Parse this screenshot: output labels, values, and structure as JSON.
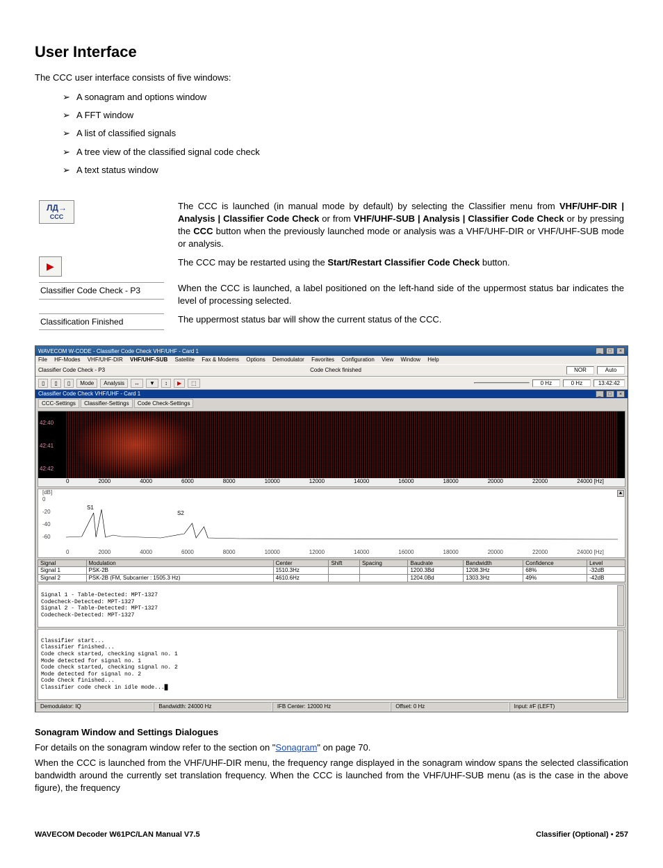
{
  "title": "User Interface",
  "intro": "The CCC user interface consists of five windows:",
  "bullets": [
    "A sonagram and options window",
    "A FFT window",
    "A list of classified signals",
    "A tree view of the classified signal code check",
    "A text status window"
  ],
  "rows": [
    {
      "left_kind": "ccc-icon",
      "html": "The CCC is launched (in manual mode by default) by selecting the Classifier menu from <b>VHF/UHF-DIR | Analysis | Classifier Code Check</b> or from <b>VHF/UHF-SUB | Analysis | Classifier Code Check</b> or by pressing the <b>CCC</b> button when the previously launched mode or analysis was a VHF/UHF-DIR or VHF/UHF-SUB mode or analysis."
    },
    {
      "left_kind": "play-icon",
      "html": "The CCC may be restarted using the <b>Start/Restart Classifier Code Check</b> button."
    },
    {
      "left_kind": "label",
      "left_text": "Classifier Code Check - P3",
      "html": "When the CCC is launched, a label positioned on the left-hand side of the uppermost status bar indicates the level of processing selected."
    },
    {
      "left_kind": "label",
      "left_text": "Classification Finished",
      "html": "The uppermost status bar will show the current status of the CCC."
    }
  ],
  "app": {
    "titlebar": "WAVECOM W-CODE - Classifier Code Check VHF/UHF - Card 1",
    "menus": [
      "File",
      "HF-Modes",
      "VHF/UHF-DIR",
      "VHF/UHF-SUB",
      "Satellite",
      "Fax & Modems",
      "Options",
      "Demodulator",
      "Favorites",
      "Configuration",
      "View",
      "Window",
      "Help"
    ],
    "toolbar": {
      "mode_btn": "Mode",
      "analysis_btn": "Analysis",
      "status_left": "Classifier Code Check - P3",
      "status_mid": "Code Check finished",
      "field1": "NOR",
      "field2": "Auto",
      "hz1": "0 Hz",
      "hz2": "0 Hz",
      "time": "13:42:42"
    },
    "subtitle": "Classifier Code Check VHF/UHF - Card 1",
    "settings": [
      "CCC-Settings",
      "Classifier-Settings",
      "Code Check-Settings"
    ],
    "sona": {
      "ylabels": [
        "42:40",
        "42:41",
        "42:42"
      ],
      "xticks": [
        "0",
        "2000",
        "4000",
        "6000",
        "8000",
        "10000",
        "12000",
        "14000",
        "16000",
        "18000",
        "20000",
        "22000",
        "24000 [Hz]"
      ]
    },
    "fft": {
      "ytitle": "[dB]",
      "ylabels": [
        "0",
        "-20",
        "-40",
        "-60"
      ],
      "markers": [
        "S1",
        "S2"
      ],
      "xticks": [
        "0",
        "2000",
        "4000",
        "6000",
        "8000",
        "10000",
        "12000",
        "14000",
        "16000",
        "18000",
        "20000",
        "22000",
        "24000 [Hz]"
      ]
    },
    "sigtable": {
      "headers": [
        "Signal",
        "Modulation",
        "Center",
        "Shift",
        "Spacing",
        "Baudrate",
        "Bandwidth",
        "Confidence",
        "Level"
      ],
      "rows": [
        [
          "Signal 1",
          "PSK-2B",
          "1510.3Hz",
          "",
          "",
          "1200.3Bd",
          "1208.3Hz",
          "68%",
          "-32dB"
        ],
        [
          "Signal 2",
          "PSK-2B (FM, Subcarrier : 1505.3 Hz)",
          "4610.6Hz",
          "",
          "",
          "1204.0Bd",
          "1303.3Hz",
          "49%",
          "-42dB"
        ]
      ]
    },
    "treepanel": "Signal 1 - Table-Detected: MPT-1327\n   Codecheck-Detected: MPT-1327\nSignal 2 - Table-Detected: MPT-1327\n   Codecheck-Detected: MPT-1327",
    "logpanel": "Classifier start...\nClassifier finished...\nCode check started, checking signal no. 1\nMode detected for signal no. 1\nCode check started, checking signal no. 2\nMode detected for signal no. 2\nCode Check finished...\nClassifier code check in idle mode...█",
    "bottom_status": [
      "Demodulator: IQ",
      "Bandwidth: 24000 Hz",
      "IFB Center: 12000 Hz",
      "Offset: 0 Hz",
      "Input: #F (LEFT)"
    ]
  },
  "sub_heading": "Sonagram Window and Settings Dialogues",
  "para_link_pre": "For details on the sonagram window refer to the section on \"",
  "para_link_text": "Sonagram",
  "para_link_post": "\" on page 70.",
  "para2": "When the CCC is launched from the VHF/UHF-DIR menu, the frequency range displayed in the sonagram window spans the selected classification bandwidth around the currently set translation frequency. When the CCC is launched from the VHF/UHF-SUB menu (as is the case in the above figure), the frequency",
  "footer_left": "WAVECOM Decoder W61PC/LAN Manual V7.5",
  "footer_right_section": "Classifier (Optional)",
  "footer_page": "257"
}
